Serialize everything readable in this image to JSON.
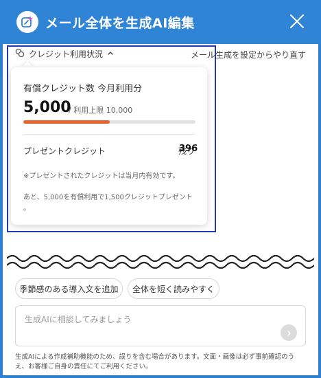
{
  "header": {
    "title": "メール全体を生成AI編集",
    "logo_icon": "sparkle-edit-icon",
    "close_icon": "close-icon",
    "color": "#2f84d6"
  },
  "toolbar": {
    "credit_status_label": "クレジット利用状況",
    "credit_icon": "coins-icon",
    "chevron_icon": "chevron-up-icon",
    "reset_link": "メール生成を設定からやり直す"
  },
  "credit_popover": {
    "title": "有償クレジット数 今月利用分",
    "used": "5,000",
    "limit_text": "/ 利用上限 10,000",
    "progress_fraction": 0.5,
    "progress_color": "#e8632a",
    "present_label": "プレゼントクレジット",
    "remain_label": "残り",
    "remain_value": "396",
    "note1": "※プレゼントされたクレジットは当月内有効です。",
    "note2": "あと、5,000を有償利用で1,500クレジットプレゼント",
    "note3": "。"
  },
  "suggestions": [
    {
      "label": "季節感のある導入文を追加"
    },
    {
      "label": "全体を短く読みやすく"
    }
  ],
  "chat": {
    "placeholder": "生成AIに相談してみましょう",
    "send_icon": "chevron-right-icon"
  },
  "disclaimer": "生成AIによる作成補助機能のため、誤りを含む場合があります。文面・画像は必ず事前確認のうえ、お客様ご自身の責任にてご利用ください。"
}
